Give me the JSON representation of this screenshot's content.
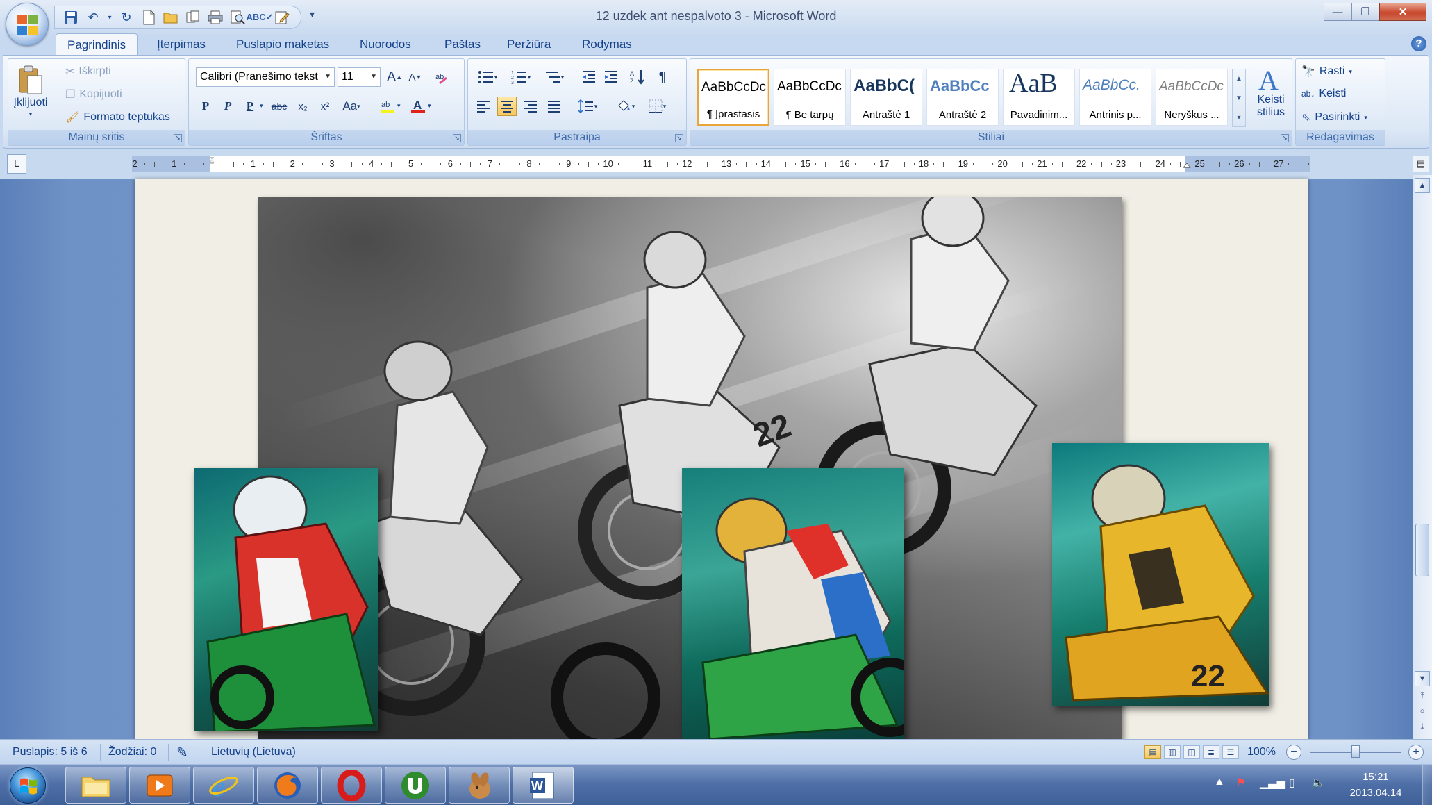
{
  "window": {
    "title": "12 uzdek ant nespalvoto 3 - Microsoft Word",
    "controls": {
      "minimize": "—",
      "restore": "❐",
      "close": "✕"
    }
  },
  "quick_access": {
    "icons": [
      "save-icon",
      "undo-icon",
      "redo-icon",
      "new-icon",
      "open-icon",
      "copy-icon",
      "print-icon",
      "print-preview-icon",
      "spelling-icon",
      "edit-icon"
    ],
    "more": "▾"
  },
  "tabs": [
    {
      "label": "Pagrindinis",
      "active": true
    },
    {
      "label": "Įterpimas"
    },
    {
      "label": "Puslapio maketas"
    },
    {
      "label": "Nuorodos"
    },
    {
      "label": "Paštas"
    },
    {
      "label": "Peržiūra"
    },
    {
      "label": "Rodymas"
    }
  ],
  "ribbon": {
    "clipboard": {
      "label": "Mainų sritis",
      "paste": "Įklijuoti",
      "cut": "Iškirpti",
      "copy": "Kopijuoti",
      "format_painter": "Formato teptukas"
    },
    "font": {
      "label": "Šriftas",
      "family": "Calibri (Pranešimo tekst",
      "size": "11",
      "bold": "P",
      "italic": "P",
      "underline": "P",
      "strike": "abc",
      "subscript": "x₂",
      "superscript": "x²",
      "case": "Aa",
      "grow": "A",
      "shrink": "A"
    },
    "paragraph": {
      "label": "Pastraipa",
      "pilcrow": "¶"
    },
    "styles": {
      "label": "Stiliai",
      "items": [
        {
          "sample": "AaBbCcDc",
          "name": "¶ Įprastasis",
          "selected": true
        },
        {
          "sample": "AaBbCcDc",
          "name": "¶ Be tarpų"
        },
        {
          "sample": "AaBbC(",
          "name": "Antraštė 1"
        },
        {
          "sample": "AaBbCc",
          "name": "Antraštė 2"
        },
        {
          "sample": "AaB",
          "name": "Pavadinim..."
        },
        {
          "sample": "AaBbCc.",
          "name": "Antrinis p..."
        },
        {
          "sample": "AaBbCcDc",
          "name": "Neryškus ..."
        }
      ],
      "change_styles_line1": "Keisti",
      "change_styles_line2": "stilius"
    },
    "editing": {
      "label": "Redagavimas",
      "find": "Rasti",
      "replace": "Keisti",
      "select": "Pasirinkti"
    }
  },
  "ruler": {
    "tab_selector": "L",
    "labels": [
      "2",
      "1",
      "",
      "1",
      "2",
      "3",
      "4",
      "5",
      "6",
      "7",
      "8",
      "9",
      "10",
      "11",
      "12",
      "13",
      "14",
      "15",
      "16",
      "17",
      "18",
      "19",
      "20",
      "21",
      "22",
      "23",
      "24",
      "25",
      "26",
      "27"
    ]
  },
  "statusbar": {
    "page": "Puslapis: 5 iš 6",
    "words": "Žodžiai: 0",
    "language": "Lietuvių (Lietuva)",
    "zoom": "100%",
    "zoom_level": 1.0
  },
  "taskbar": {
    "apps": [
      "explorer-icon",
      "media-player-icon",
      "internet-explorer-icon",
      "firefox-icon",
      "opera-icon",
      "utorrent-icon",
      "hamster-app-icon",
      "word-icon"
    ],
    "time": "15:21",
    "date": "2013.04.14"
  }
}
